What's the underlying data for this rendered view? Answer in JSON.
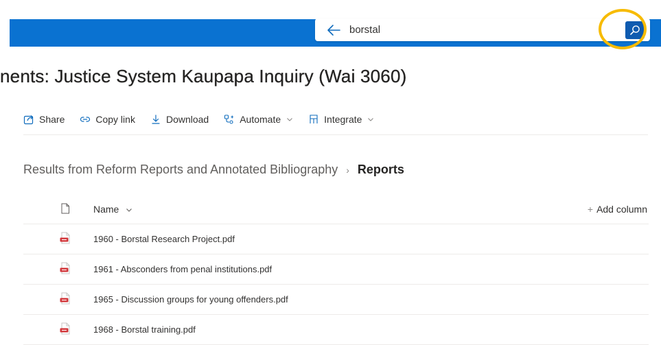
{
  "search": {
    "query": "borstal"
  },
  "page": {
    "title": "nents: Justice System Kaupapa Inquiry (Wai 3060)"
  },
  "commands": [
    {
      "label": "Share",
      "icon": "share-icon"
    },
    {
      "label": "Copy link",
      "icon": "link-icon"
    },
    {
      "label": "Download",
      "icon": "download-icon"
    },
    {
      "label": "Automate",
      "icon": "automate-icon"
    },
    {
      "label": "Integrate",
      "icon": "integrate-icon"
    }
  ],
  "breadcrumb": {
    "parent": "Results from Reform Reports and Annotated Bibliography",
    "current": "Reports"
  },
  "list": {
    "name_header": "Name",
    "add_column": "Add column",
    "files": [
      "1960 - Borstal Research Project.pdf",
      "1961 - Absconders from penal institutions.pdf",
      "1965 - Discussion groups for young offenders.pdf",
      "1968 - Borstal training.pdf"
    ]
  },
  "colors": {
    "brand": "#0a72d1",
    "search_button": "#0f5bb0",
    "highlight": "#f7bb00",
    "pdf": "#d13438"
  }
}
